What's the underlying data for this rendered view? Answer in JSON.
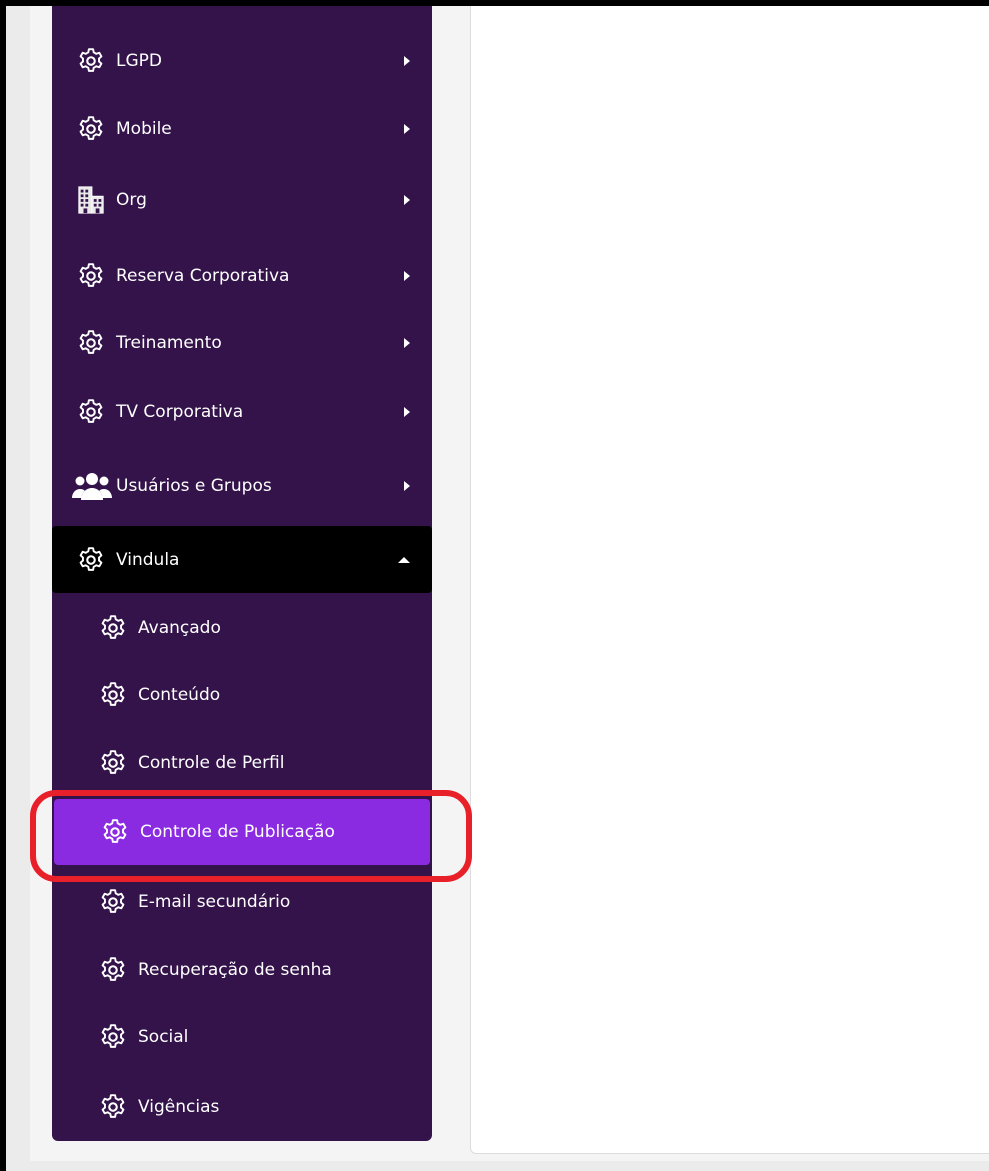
{
  "colors": {
    "sidebar_bg": "#33134a",
    "active_parent_bg": "#000000",
    "active_child_bg": "#8a2be2",
    "highlight_ring": "#e8202a"
  },
  "sidebar": {
    "items": [
      {
        "label": "LGPD",
        "icon": "gear-icon"
      },
      {
        "label": "Mobile",
        "icon": "gear-icon"
      },
      {
        "label": "Org",
        "icon": "building-icon"
      },
      {
        "label": "Reserva Corporativa",
        "icon": "gear-icon"
      },
      {
        "label": "Treinamento",
        "icon": "gear-icon"
      },
      {
        "label": "TV Corporativa",
        "icon": "gear-icon"
      },
      {
        "label": "Usuários e Grupos",
        "icon": "users-icon"
      },
      {
        "label": "Vindula",
        "icon": "gear-icon",
        "expanded": true
      }
    ],
    "vindula_children": [
      {
        "label": "Avançado",
        "icon": "gear-icon"
      },
      {
        "label": "Conteúdo",
        "icon": "gear-icon"
      },
      {
        "label": "Controle de Perfil",
        "icon": "gear-icon"
      },
      {
        "label": "Controle de Publicação",
        "icon": "gear-icon",
        "active": true
      },
      {
        "label": "E-mail secundário",
        "icon": "gear-icon"
      },
      {
        "label": "Recuperação de senha",
        "icon": "gear-icon"
      },
      {
        "label": "Social",
        "icon": "gear-icon"
      },
      {
        "label": "Vigências",
        "icon": "gear-icon"
      }
    ]
  }
}
